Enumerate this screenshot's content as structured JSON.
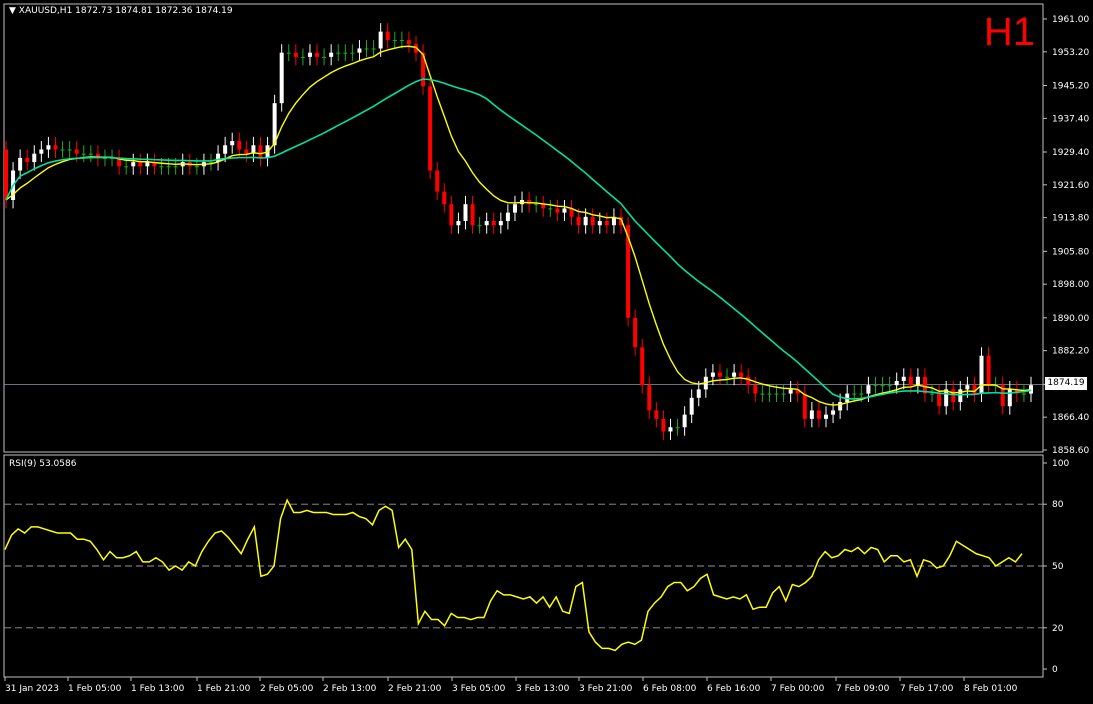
{
  "header": {
    "symbol_line": "XAUUSD,H1  1872.73 1874.81 1872.36 1874.19",
    "timeframe_badge": "H1",
    "rsi_label": "RSI(9) 53.0586",
    "current_price": "1874.19"
  },
  "colors": {
    "background": "#000000",
    "frame": "#c0c0c0",
    "bull_candle": "#ffffff",
    "bear_candle": "#ff0000",
    "doji": "#22aa22",
    "ma_fast": "#ffff00",
    "ma_slow": "#00e0a0",
    "rsi_line": "#ffff00",
    "badge": "#ff0000"
  },
  "chart_data": [
    {
      "type": "candlestick",
      "title": "XAUUSD,H1",
      "ylim": [
        1858.6,
        1961.0
      ],
      "y_ticks": [
        "1961.00",
        "1953.20",
        "1945.20",
        "1937.40",
        "1929.40",
        "1921.60",
        "1913.80",
        "1905.80",
        "1898.00",
        "1890.00",
        "1882.20",
        "1874.19",
        "1866.40",
        "1858.60"
      ],
      "x_ticks": [
        "31 Jan 2023",
        "1 Feb 05:00",
        "1 Feb 13:00",
        "1 Feb 21:00",
        "2 Feb 05:00",
        "2 Feb 13:00",
        "2 Feb 21:00",
        "3 Feb 05:00",
        "3 Feb 13:00",
        "3 Feb 21:00",
        "6 Feb 08:00",
        "6 Feb 16:00",
        "7 Feb 00:00",
        "7 Feb 09:00",
        "7 Feb 17:00",
        "8 Feb 01:00"
      ],
      "closes": [
        1918,
        1925,
        1928,
        1927,
        1929,
        1930,
        1931,
        1930,
        1930,
        1930,
        1929,
        1929,
        1929,
        1928,
        1928,
        1928,
        1926,
        1926,
        1927,
        1926,
        1927,
        1926,
        1926,
        1926,
        1926,
        1927,
        1926,
        1926,
        1927,
        1927,
        1929,
        1931,
        1932,
        1930,
        1929,
        1931,
        1928,
        1931,
        1941,
        1953,
        1953,
        1952,
        1952,
        1953,
        1952,
        1952,
        1953,
        1953,
        1953,
        1953,
        1954,
        1954,
        1954,
        1958,
        1956,
        1956,
        1956,
        1955,
        1953,
        1945,
        1925,
        1920,
        1917,
        1912,
        1913,
        1917,
        1912,
        1912,
        1913,
        1912,
        1913,
        1915,
        1917,
        1918,
        1917,
        1917,
        1916,
        1916,
        1915,
        1916,
        1914,
        1912,
        1914,
        1912,
        1913,
        1912,
        1914,
        1912,
        1890,
        1883,
        1874,
        1868,
        1866,
        1863,
        1864,
        1864,
        1867,
        1871,
        1873,
        1876,
        1877,
        1876,
        1876,
        1877,
        1876,
        1874,
        1872,
        1872,
        1872,
        1872,
        1872,
        1873,
        1872,
        1866,
        1868,
        1866,
        1867,
        1868,
        1870,
        1872,
        1872,
        1872,
        1874,
        1874,
        1874,
        1874,
        1875,
        1876,
        1874,
        1876,
        1872,
        1872,
        1869,
        1873,
        1870,
        1873,
        1874,
        1872,
        1881,
        1874,
        1874,
        1869,
        1873,
        1872,
        1872,
        1874
      ],
      "ma_fast_last": 1874.0,
      "ma_slow_last": 1880.0
    },
    {
      "type": "line",
      "title": "RSI(9) 53.0586",
      "ylim": [
        0,
        100
      ],
      "y_ticks": [
        "100",
        "80",
        "50",
        "20",
        "0"
      ],
      "levels": [
        80,
        50,
        20
      ],
      "values": [
        58,
        65,
        68,
        66,
        69,
        69,
        68,
        67,
        66,
        66,
        66,
        63,
        63,
        62,
        58,
        53,
        57,
        54,
        54,
        55,
        57,
        52,
        52,
        54,
        52,
        48,
        50,
        48,
        52,
        50,
        57,
        62,
        66,
        67,
        64,
        60,
        56,
        63,
        69,
        45,
        46,
        50,
        73,
        82,
        76,
        76,
        77,
        76,
        76,
        76,
        75,
        75,
        75,
        76,
        74,
        73,
        70,
        77,
        79,
        77,
        59,
        63,
        58,
        22,
        28,
        24,
        24,
        21,
        27,
        25,
        25,
        24,
        25,
        25,
        33,
        38,
        36,
        36,
        35,
        34,
        35,
        32,
        35,
        30,
        35,
        28,
        27,
        40,
        42,
        18,
        13,
        10,
        10,
        9,
        12,
        13,
        12,
        14,
        28,
        32,
        35,
        40,
        42,
        42,
        38,
        40,
        44,
        46,
        36,
        35,
        34,
        35,
        34,
        36,
        29,
        30,
        30,
        37,
        40,
        33,
        41,
        40,
        42,
        45,
        53,
        57,
        54,
        55,
        58,
        57,
        59,
        56,
        59,
        58,
        52,
        55,
        55,
        52,
        53,
        45,
        53,
        52,
        49,
        50,
        55,
        62,
        60,
        58,
        56,
        55,
        54,
        50,
        52,
        54,
        52,
        56
      ]
    }
  ]
}
